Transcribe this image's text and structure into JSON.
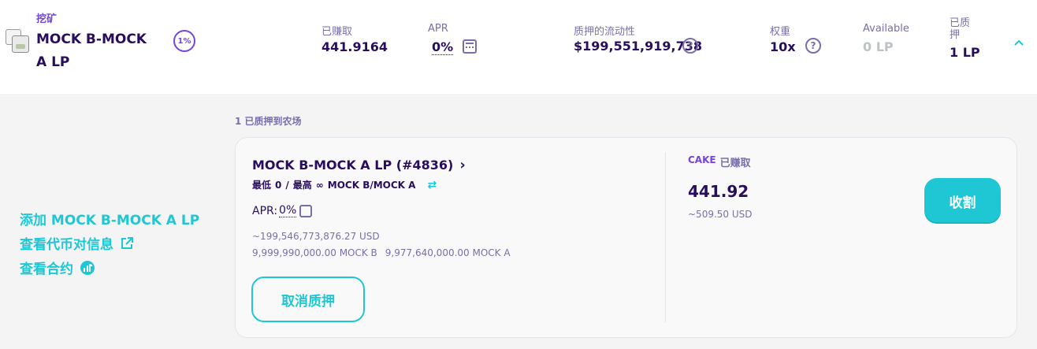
{
  "farm_row": {
    "tag": "挖矿",
    "pair_name": "MOCK B-MOCK A LP",
    "fee_badge": "1%",
    "earned": {
      "label": "已赚取",
      "value": "441.9164"
    },
    "apr": {
      "label": "APR",
      "value": "0%"
    },
    "liquidity": {
      "label": "质押的流动性",
      "value": "$199,551,919,738"
    },
    "multiplier": {
      "label": "权重",
      "value": "10x"
    },
    "available": {
      "label": "Available",
      "value": "0 LP"
    },
    "staked": {
      "label": "已质押",
      "value": "1 LP"
    }
  },
  "details": {
    "links": {
      "add_liquidity": "添加 MOCK B-MOCK A LP",
      "view_pair_info": "查看代币对信息",
      "view_contract": "查看合约"
    },
    "section_title": "1 已质押到农场",
    "position": {
      "title": "MOCK B-MOCK A LP (#4836)",
      "min_label": "最低",
      "min_value": "0",
      "separator": "/",
      "max_label": "最高",
      "max_value": "∞",
      "pair_unit": "MOCK B/MOCK A",
      "apr_label": "APR:",
      "apr_value": "0%",
      "usd_value": "~199,546,773,876.27 USD",
      "token_b_amount": "9,999,990,000.00 MOCK B",
      "token_a_amount": "9,977,640,000.00 MOCK A",
      "unstake_label": "取消质押"
    },
    "earnings": {
      "token": "CAKE",
      "label": "已赚取",
      "amount": "441.92",
      "usd": "~509.50 USD",
      "harvest_label": "收割"
    }
  },
  "colors": {
    "primary": "#1fc7d4",
    "secondary": "#7645d9",
    "text": "#280d5f",
    "text_subtle": "#7a6eaa",
    "disabled": "#bdc2c4"
  }
}
